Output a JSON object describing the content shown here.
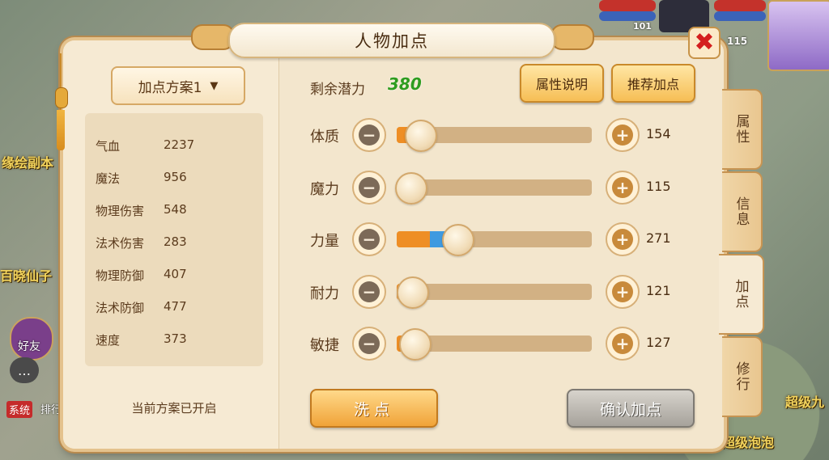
{
  "background": {
    "labels": [
      "缘绘副本",
      "百晓仙子",
      "超级九",
      "超级泡泡"
    ],
    "chat": {
      "friends": "好友",
      "system": "系统",
      "rank": "排行"
    },
    "top_numbers": [
      "101",
      "115"
    ]
  },
  "panel": {
    "title": "人物加点",
    "close_symbol": "✖"
  },
  "plan": {
    "dropdown_label": "加点方案1",
    "status": "当前方案已开启"
  },
  "stats": [
    {
      "name": "气血",
      "value": "2237"
    },
    {
      "name": "魔法",
      "value": "956"
    },
    {
      "name": "物理伤害",
      "value": "548"
    },
    {
      "name": "法术伤害",
      "value": "283"
    },
    {
      "name": "物理防御",
      "value": "407"
    },
    {
      "name": "法术防御",
      "value": "477"
    },
    {
      "name": "速度",
      "value": "373"
    }
  ],
  "potential": {
    "label": "剩余潜力",
    "value": "380"
  },
  "buttons": {
    "attr_help": "属性说明",
    "recommend": "推荐加点",
    "wash": "洗点",
    "confirm": "确认加点",
    "minus": "−",
    "plus": "+"
  },
  "attributes": [
    {
      "name": "体质",
      "value": "154",
      "base_fraction": 0.1,
      "added_fraction": 0.0
    },
    {
      "name": "魔力",
      "value": "115",
      "base_fraction": 0.05,
      "added_fraction": 0.0
    },
    {
      "name": "力量",
      "value": "271",
      "base_fraction": 0.17,
      "added_fraction": 0.12
    },
    {
      "name": "耐力",
      "value": "121",
      "base_fraction": 0.06,
      "added_fraction": 0.0
    },
    {
      "name": "敏捷",
      "value": "127",
      "base_fraction": 0.07,
      "added_fraction": 0.0
    }
  ],
  "side_tabs": [
    {
      "label": "属性",
      "active": false
    },
    {
      "label": "信息",
      "active": false
    },
    {
      "label": "加点",
      "active": true
    },
    {
      "label": "修行",
      "active": false
    }
  ],
  "colors": {
    "potential": "#2e9c1f",
    "fill_base": "#ee8e25",
    "fill_added": "#3f9ae0",
    "close": "#d41e1e"
  }
}
